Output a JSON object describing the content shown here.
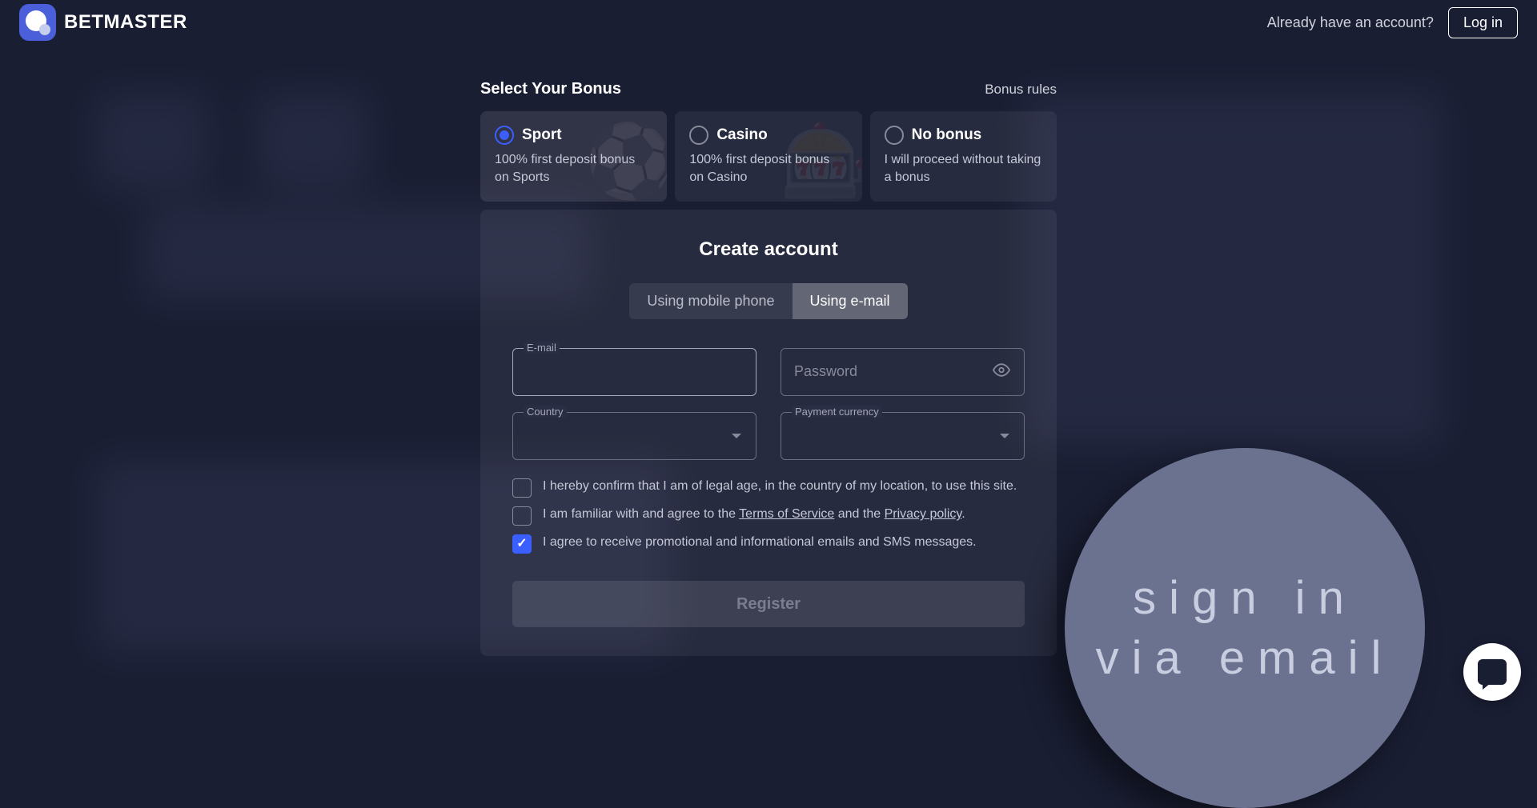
{
  "header": {
    "brand": "BETMASTER",
    "have_account": "Already have an account?",
    "login": "Log in"
  },
  "bonus": {
    "select_title": "Select Your Bonus",
    "rules": "Bonus rules",
    "cards": [
      {
        "title": "Sport",
        "desc": "100% first deposit bonus on Sports",
        "selected": true
      },
      {
        "title": "Casino",
        "desc": "100% first deposit bonus on Casino",
        "selected": false
      },
      {
        "title": "No bonus",
        "desc": "I will proceed without taking a bonus",
        "selected": false
      }
    ]
  },
  "form": {
    "title": "Create account",
    "tabs": {
      "mobile": "Using mobile phone",
      "email": "Using e-mail"
    },
    "email_label": "E-mail",
    "password_placeholder": "Password",
    "country_label": "Country",
    "currency_label": "Payment currency",
    "check_age": "I hereby confirm that I am of legal age, in the country of my location, to use this site.",
    "check_terms_prefix": "I am familiar with and agree to the ",
    "terms_link": "Terms of Service",
    "check_terms_middle": " and the ",
    "privacy_link": "Privacy policy",
    "check_terms_suffix": ".",
    "check_promo": "I agree to receive promotional and informational emails and SMS messages.",
    "register": "Register"
  },
  "circle": {
    "line1": "sign in",
    "line2": "via email"
  }
}
